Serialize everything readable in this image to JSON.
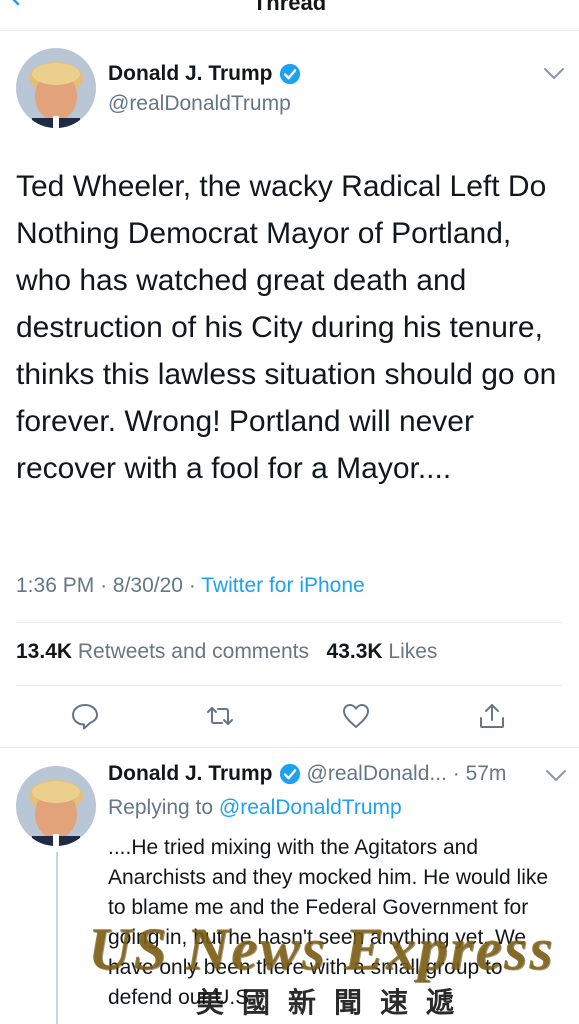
{
  "header": {
    "title": "Thread",
    "back_icon": "back-chevron-icon"
  },
  "tweet": {
    "author_name": "Donald J. Trump",
    "handle": "@realDonaldTrump",
    "text": "Ted Wheeler, the wacky Radical Left Do Nothing Democrat Mayor of Portland, who has watched great death and destruction of his City during his tenure, thinks this lawless situation should go on forever. Wrong! Portland will never recover with a fool for a Mayor....",
    "time": "1:36 PM",
    "date": "8/30/20",
    "separator": "·",
    "source": "Twitter for iPhone",
    "retweets_count": "13.4K",
    "retweets_label": "Retweets and comments",
    "likes_count": "43.3K",
    "likes_label": "Likes"
  },
  "reply": {
    "author_name": "Donald J. Trump",
    "handle_time": "@realDonald... · 57m",
    "replying_label": "Replying to",
    "replying_to": "@realDonaldTrump",
    "text": "....He tried mixing with the Agitators and Anarchists and they mocked him. He would like to blame me and the Federal Government for going in, but he hasn't seen anything yet. We have only been there with a small group to defend our U.S."
  },
  "watermark": {
    "english": "US News Express",
    "chinese": "美國新聞速遞"
  },
  "colors": {
    "accent": "#1da1f2",
    "secondary_text": "#657786",
    "divider": "#e6ecf0"
  }
}
